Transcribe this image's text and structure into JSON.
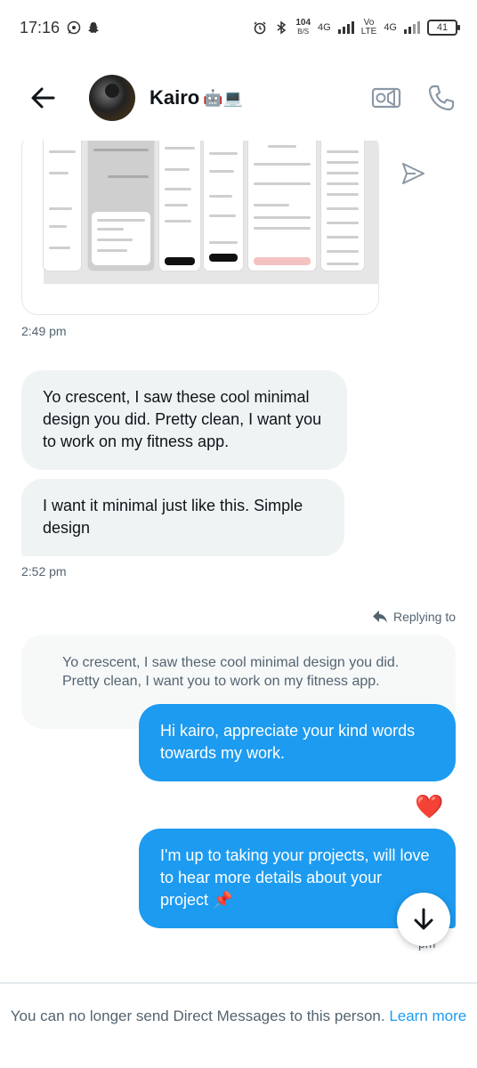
{
  "status_bar": {
    "time": "17:16",
    "net_speed_value": "104",
    "net_speed_unit": "B/S",
    "network1": "4G",
    "volte_top": "Vo",
    "volte_bottom": "LTE",
    "network2": "4G",
    "battery": "41"
  },
  "header": {
    "contact_name": "Kairo",
    "contact_emoji": "🤖💻"
  },
  "messages": [
    {
      "type": "image",
      "timestamp": "2:49 pm"
    },
    {
      "type": "incoming",
      "text": "Yo crescent, I saw these cool minimal design you did. Pretty clean, I want you to work on my fitness app."
    },
    {
      "type": "incoming",
      "text": "I want it minimal just like this. Simple design",
      "timestamp": "2:52 pm"
    },
    {
      "type": "outgoing",
      "replying_label": "Replying to",
      "reply_context": "Yo crescent, I saw these cool minimal design you did. Pretty clean, I want you to work on my fitness app.",
      "text": "Hi kairo, appreciate your kind words towards my work.",
      "reaction": "❤️"
    },
    {
      "type": "outgoing",
      "text": "I'm up to taking your projects, will love to hear more details about your project 📌",
      "timestamp_partial": "pm"
    }
  ],
  "footer": {
    "text": "You can no longer send Direct Messages to this person.",
    "link": "Learn more"
  },
  "icons": {
    "back": "arrow-left-icon",
    "video": "video-camera-icon",
    "phone": "phone-icon",
    "share": "send-icon",
    "reply": "reply-arrow-icon",
    "scroll": "arrow-down-icon"
  },
  "colors": {
    "accent": "#1d9bf0",
    "incoming_bubble": "#eff3f4",
    "muted_text": "#536471",
    "reaction": "#e0245e"
  }
}
